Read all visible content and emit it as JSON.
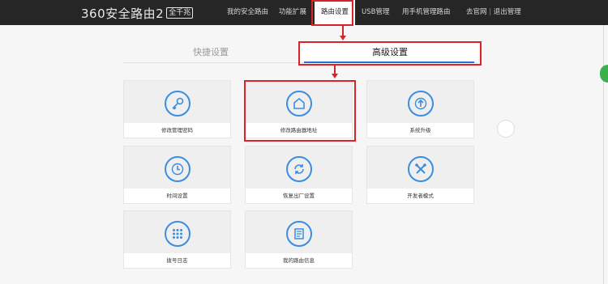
{
  "header": {
    "logo_text": "360安全路由2",
    "logo_badge": "全千兆",
    "nav": [
      {
        "label": "我的安全路由"
      },
      {
        "label": "功能扩展"
      },
      {
        "label": "路由设置"
      },
      {
        "label": "USB管理"
      },
      {
        "label": "用手机管理路由"
      }
    ],
    "links": [
      "去官网",
      "退出管理"
    ]
  },
  "tabs": {
    "quick": "快捷设置",
    "advanced": "高级设置"
  },
  "cards": [
    {
      "label": "修改管理密码",
      "icon": "key-icon"
    },
    {
      "label": "修改路由器地址",
      "icon": "home-icon"
    },
    {
      "label": "系统升级",
      "icon": "upload-arrow-icon"
    },
    {
      "label": "时间设置",
      "icon": "clock-icon"
    },
    {
      "label": "恢复出厂设置",
      "icon": "refresh-icon"
    },
    {
      "label": "开发者模式",
      "icon": "tools-icon"
    },
    {
      "label": "拨号日志",
      "icon": "dot-grid-icon"
    },
    {
      "label": "我的路由信息",
      "icon": "document-icon"
    }
  ],
  "colors": {
    "topbar": "#262626",
    "accent_blue": "#3a8de0",
    "annotation_red": "#d8232a"
  }
}
